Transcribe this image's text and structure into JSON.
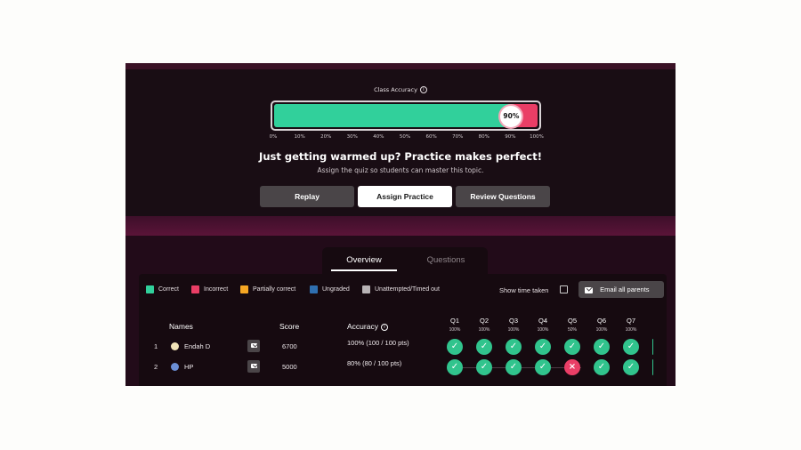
{
  "accuracy": {
    "title": "Class Accuracy",
    "value_percent": 90,
    "label": "90%",
    "ticks": [
      "0%",
      "10%",
      "20%",
      "30%",
      "40%",
      "50%",
      "60%",
      "70%",
      "80%",
      "90%",
      "100%"
    ]
  },
  "message": {
    "headline": "Just getting warmed up? Practice makes perfect!",
    "sub": "Assign the quiz so students can master this topic."
  },
  "actions": {
    "replay": "Replay",
    "assign": "Assign Practice",
    "review": "Review Questions"
  },
  "tabs": {
    "overview": "Overview",
    "questions": "Questions"
  },
  "legend": [
    {
      "label": "Correct",
      "color": "#31d09b"
    },
    {
      "label": "Incorrect",
      "color": "#ea3e66"
    },
    {
      "label": "Partially correct",
      "color": "#f5a623"
    },
    {
      "label": "Ungraded",
      "color": "#2f6fb0"
    },
    {
      "label": "Unattempted/Timed out",
      "color": "#b8b3b5"
    }
  ],
  "controls": {
    "show_time": "Show time taken",
    "email_all": "Email all parents"
  },
  "table": {
    "headers": {
      "names": "Names",
      "score": "Score",
      "accuracy": "Accuracy"
    },
    "questions": [
      {
        "label": "Q1",
        "pct": "100%"
      },
      {
        "label": "Q2",
        "pct": "100%"
      },
      {
        "label": "Q3",
        "pct": "100%"
      },
      {
        "label": "Q4",
        "pct": "100%"
      },
      {
        "label": "Q5",
        "pct": "50%"
      },
      {
        "label": "Q6",
        "pct": "100%"
      },
      {
        "label": "Q7",
        "pct": "100%"
      }
    ],
    "rows": [
      {
        "rank": "1",
        "name": "Endah D",
        "score": "6700",
        "accuracy": "100% (100 / 100 pts)",
        "results": [
          "correct",
          "correct",
          "correct",
          "correct",
          "correct",
          "correct",
          "correct",
          "correct"
        ]
      },
      {
        "rank": "2",
        "name": "HP",
        "score": "5000",
        "accuracy": "80% (80 / 100 pts)",
        "results": [
          "correct",
          "correct",
          "correct",
          "correct",
          "incorrect",
          "correct",
          "correct",
          "correct"
        ]
      }
    ]
  }
}
